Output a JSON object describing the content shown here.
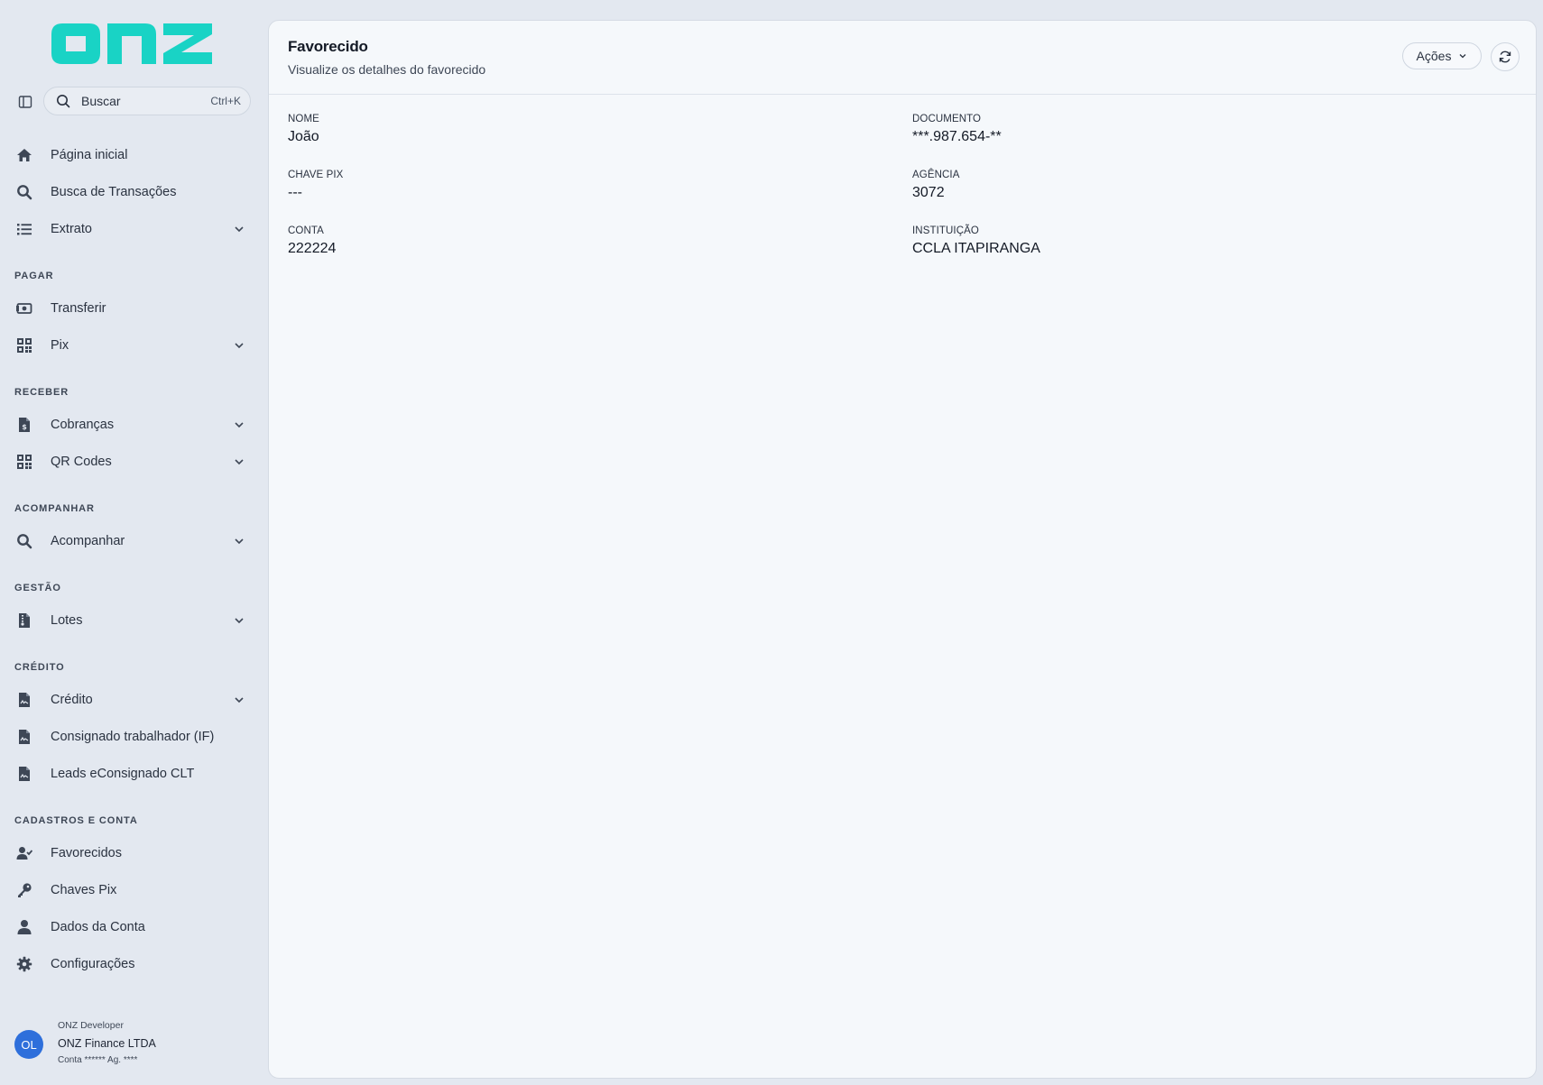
{
  "brand": {
    "logo_text": "onz",
    "accent": "#19d3c5"
  },
  "search": {
    "label": "Buscar",
    "shortcut": "Ctrl+K"
  },
  "nav": {
    "home": "Página inicial",
    "busca": "Busca de Transações",
    "extrato": "Extrato",
    "sec_pagar": "PAGAR",
    "transferir": "Transferir",
    "pix": "Pix",
    "sec_receber": "RECEBER",
    "cobrancas": "Cobranças",
    "qrcodes": "QR Codes",
    "sec_acompanhar": "ACOMPANHAR",
    "acompanhar": "Acompanhar",
    "sec_gestao": "GESTÃO",
    "lotes": "Lotes",
    "sec_credito": "CRÉDITO",
    "credito": "Crédito",
    "consignado": "Consignado trabalhador (IF)",
    "leads": "Leads eConsignado CLT",
    "sec_cadastros": "CADASTROS E CONTA",
    "favorecidos": "Favorecidos",
    "chaves": "Chaves Pix",
    "dados": "Dados da Conta",
    "config": "Configurações"
  },
  "user": {
    "initials": "OL",
    "role": "ONZ Developer",
    "company": "ONZ Finance LTDA",
    "account": "Conta ****** Ag. ****"
  },
  "page": {
    "title": "Favorecido",
    "subtitle": "Visualize os detalhes do favorecido",
    "actions_label": "Ações"
  },
  "details": {
    "nome_label": "NOME",
    "nome": "João",
    "documento_label": "DOCUMENTO",
    "documento": "***.987.654-**",
    "chave_label": "CHAVE PIX",
    "chave": "---",
    "agencia_label": "AGÊNCIA",
    "agencia": "3072",
    "conta_label": "CONTA",
    "conta": "222224",
    "instituicao_label": "INSTITUIÇÃO",
    "instituicao": "CCLA ITAPIRANGA"
  }
}
